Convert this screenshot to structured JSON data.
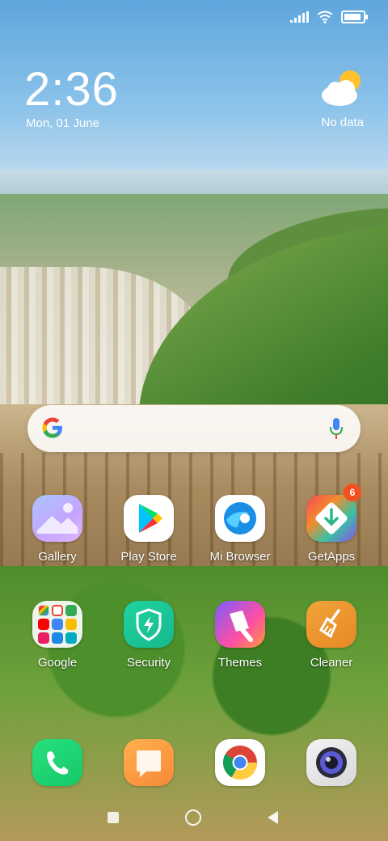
{
  "status_bar": {
    "signal_icon": "signal-bars-icon",
    "wifi_icon": "wifi-icon",
    "battery_icon": "battery-icon",
    "battery_level": 0.9
  },
  "clock": {
    "time": "2:36",
    "date": "Mon, 01 June"
  },
  "weather": {
    "icon": "partly-cloudy-icon",
    "text": "No data"
  },
  "search": {
    "google_icon": "google-logo-icon",
    "mic_icon": "microphone-icon"
  },
  "apps": [
    {
      "label": "Gallery",
      "icon": "gallery-icon"
    },
    {
      "label": "Play Store",
      "icon": "play-store-icon"
    },
    {
      "label": "Mi Browser",
      "icon": "mi-browser-icon"
    },
    {
      "label": "GetApps",
      "icon": "getapps-icon",
      "badge": "6"
    },
    {
      "label": "Google",
      "icon": "google-folder-icon"
    },
    {
      "label": "Security",
      "icon": "security-shield-icon"
    },
    {
      "label": "Themes",
      "icon": "themes-brush-icon"
    },
    {
      "label": "Cleaner",
      "icon": "cleaner-broom-icon"
    }
  ],
  "dock": [
    {
      "icon": "phone-icon"
    },
    {
      "icon": "messages-icon"
    },
    {
      "icon": "chrome-icon"
    },
    {
      "icon": "camera-icon"
    }
  ],
  "nav": {
    "recents": "recents-icon",
    "home": "home-icon",
    "back": "back-icon"
  },
  "colors": {
    "badge": "#f2501d",
    "security": "#1fd3a2",
    "phone": "#27e07c",
    "cleaner": "#f1a33a"
  }
}
